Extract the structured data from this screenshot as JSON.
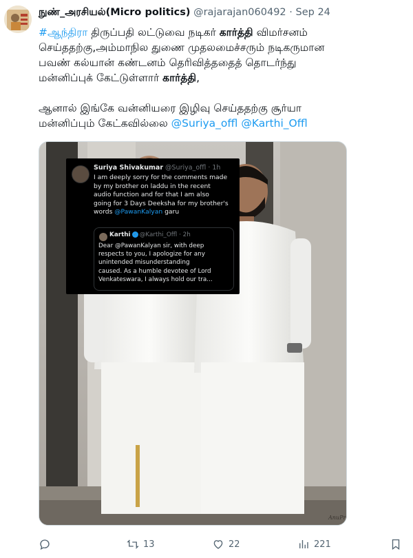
{
  "tweet": {
    "author": {
      "display_name": "நுண்_அரசியல்(Micro politics)",
      "handle": "@rajarajan060492",
      "separator": "·",
      "time": "Sep 24"
    },
    "text": {
      "l1_hashtag": "#ஆந்திரா",
      "l1_a": " திருப்பதி லட்டுவை நடிகர் ",
      "l1_bold": "கார்த்தி",
      "l1_b": " விமர்சனம்",
      "l2": "செய்ததற்கு,அம்மாநில துணை முதலமைச்சரும் நடிகருமான",
      "l3": "பவண் கல்யான் கண்டனம் தெரிவித்ததைத் தொடர்ந்து",
      "l4_a": "மன்னிப்புக் கேட்டுள்ளார் ",
      "l4_bold": "கார்த்தி",
      "l4_b": ",",
      "l5": "ஆனால் இங்கே வன்னியரை இழிவு செய்ததற்கு சூர்யா",
      "l6_a": "மன்னிப்பும் கேட்கவில்லை ",
      "mention1": "@Suriya_offl",
      "mention2": "@Karthi_Offl"
    },
    "media": {
      "quote_card": {
        "name": "Suriya Shivakumar",
        "handle_time": "@Suriya_offl · 1h",
        "lines": [
          "I am deeply sorry for the comments made",
          "by my brother on laddu in the recent",
          "audio function and for that I am also",
          "going for 3 Days Deeksha for my brother's"
        ],
        "last_line_mention": "@PawanKalyan",
        "last_line_rest": " garu",
        "last_line_prefix": "words ",
        "inner": {
          "name": "Karthi",
          "verified": "✓",
          "handle_time": "@Karthi_Offl · 2h",
          "lines": [
            "Dear @PawanKalyan sir, with deep",
            "respects to you, I apologize for any",
            "unintended misunderstanding",
            "caused. As a humble devotee of Lord",
            "Venkateswara, I always hold our tra..."
          ]
        }
      },
      "watermark": "AnuPrasath"
    },
    "actions": {
      "replies": "",
      "retweets": "13",
      "likes": "22",
      "views": "221"
    }
  },
  "colors": {
    "link": "#1d9bf0",
    "text": "#0f1419",
    "secondary": "#536471"
  }
}
